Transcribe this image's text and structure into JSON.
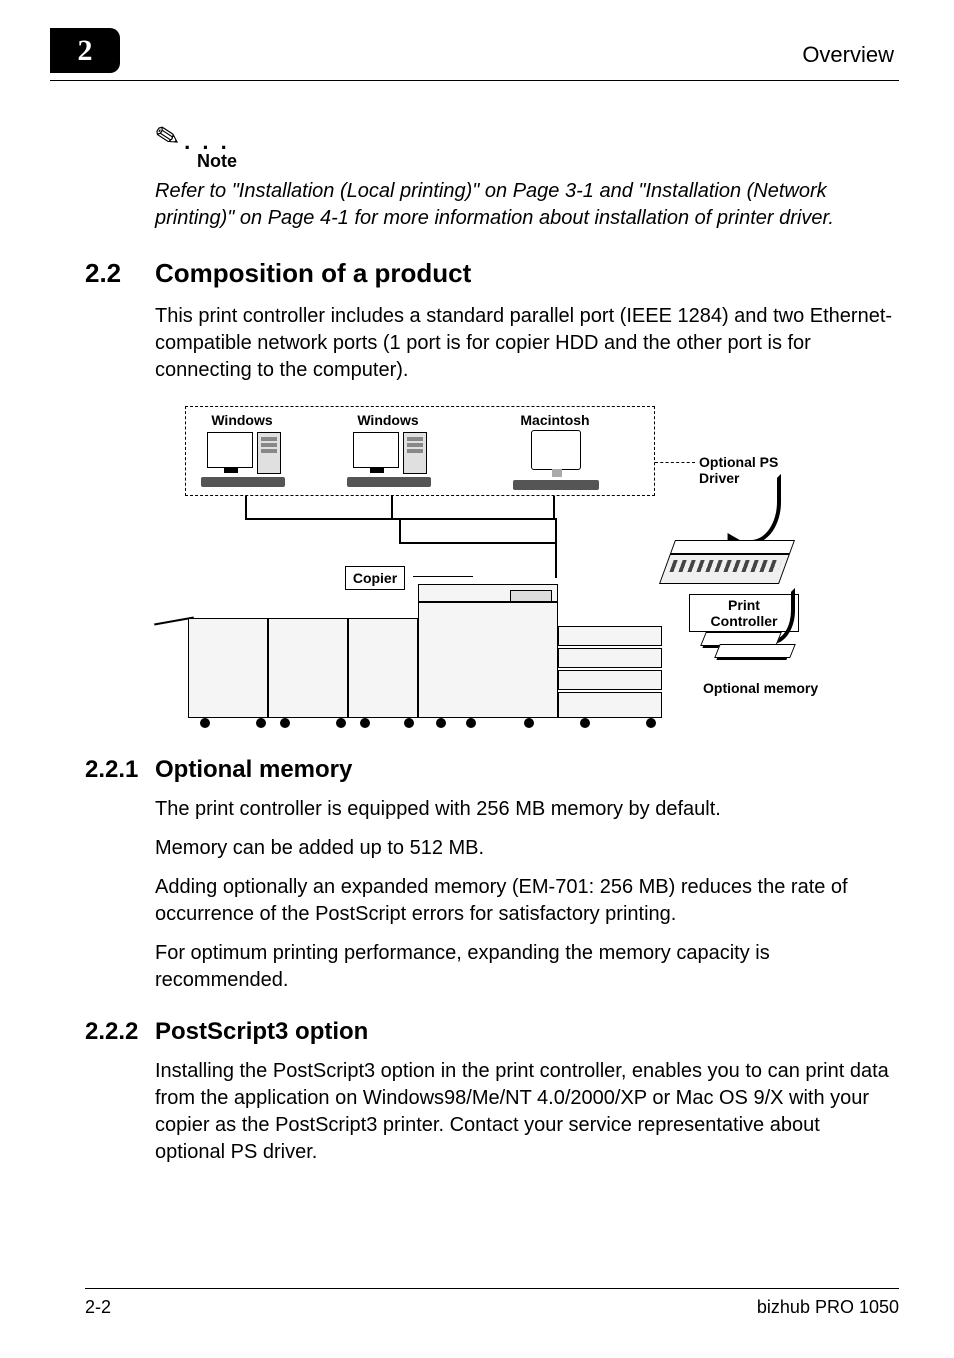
{
  "header": {
    "chapter_number": "2",
    "right_label": "Overview"
  },
  "note": {
    "label": "Note",
    "text": "Refer to \"Installation (Local printing)\" on Page 3-1 and \"Installation (Network printing)\" on Page 4-1 for more information about installation of printer driver."
  },
  "sections": {
    "s22": {
      "num": "2.2",
      "title": "Composition of a product",
      "p1": "This print controller includes a standard parallel port (IEEE 1284) and two Ethernet-compatible network ports (1 port is for copier HDD and the other port is for connecting to the computer)."
    },
    "s221": {
      "num": "2.2.1",
      "title": "Optional memory",
      "p1": "The print controller is equipped with 256 MB memory by default.",
      "p2": "Memory can be added up to 512 MB.",
      "p3": "Adding optionally an expanded memory (EM-701: 256 MB) reduces the rate of occurrence of the PostScript errors for satisfactory printing.",
      "p4": "For optimum printing performance, expanding the memory capacity is recommended."
    },
    "s222": {
      "num": "2.2.2",
      "title": "PostScript3 option",
      "p1": "Installing the PostScript3 option in the print controller, enables you to can print data from the application on Windows98/Me/NT 4.0/2000/XP or Mac OS 9/X with your copier as the PostScript3 printer. Contact your service representative about optional PS driver."
    }
  },
  "diagram": {
    "windows1": "Windows",
    "windows2": "Windows",
    "macintosh": "Macintosh",
    "optional_ps": "Optional PS Driver",
    "copier": "Copier",
    "print_controller": "Print Controller",
    "optional_memory": "Optional memory"
  },
  "footer": {
    "page": "2-2",
    "product": "bizhub PRO 1050"
  }
}
